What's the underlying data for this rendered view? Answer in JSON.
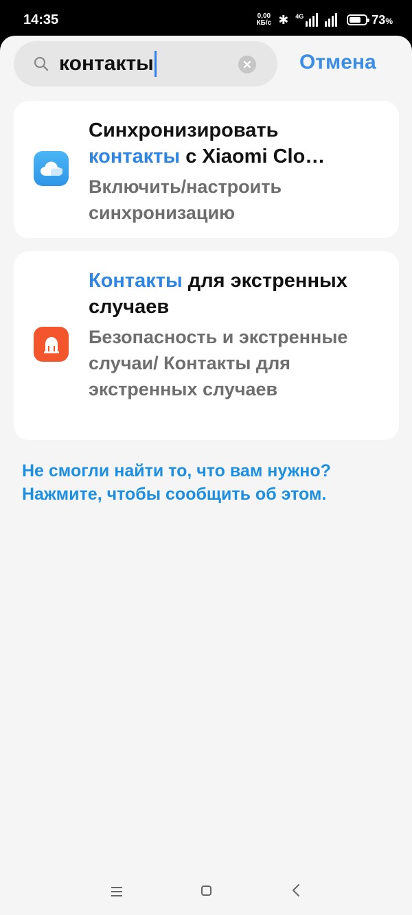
{
  "status_bar": {
    "time": "14:35",
    "net_speed_value": "0,00",
    "net_speed_unit": "КБ/с",
    "network_type": "4G",
    "battery_percent": "73",
    "battery_percent_sign": "%",
    "battery_level": 0.73
  },
  "search": {
    "query": "контакты",
    "cancel_label": "Отмена"
  },
  "results": [
    {
      "title_line1": "Синхронизировать",
      "title_highlight": "контакты",
      "title_rest": " с Xiaomi Clo…",
      "subtitle": "Включить/настроить синхронизацию",
      "icon": "xiaomi-cloud-icon"
    },
    {
      "title_highlight": "Контакты",
      "title_rest": " для экстренных случаев",
      "subtitle": "Безопасность и экстренные случаи/ Контакты для экстренных случаев",
      "icon": "emergency-sos-icon"
    }
  ],
  "report_link": "Не смогли найти то, что вам нужно? Нажмите, чтобы сообщить об этом.",
  "colors": {
    "accent": "#3b8de7",
    "highlight": "#2f85e4",
    "cloud_icon_bg": "#3aa7f0",
    "emergency_icon_bg": "#f3562d"
  },
  "nav": {
    "menu_icon": "menu-icon",
    "home_icon": "home-icon",
    "back_icon": "back-icon"
  }
}
